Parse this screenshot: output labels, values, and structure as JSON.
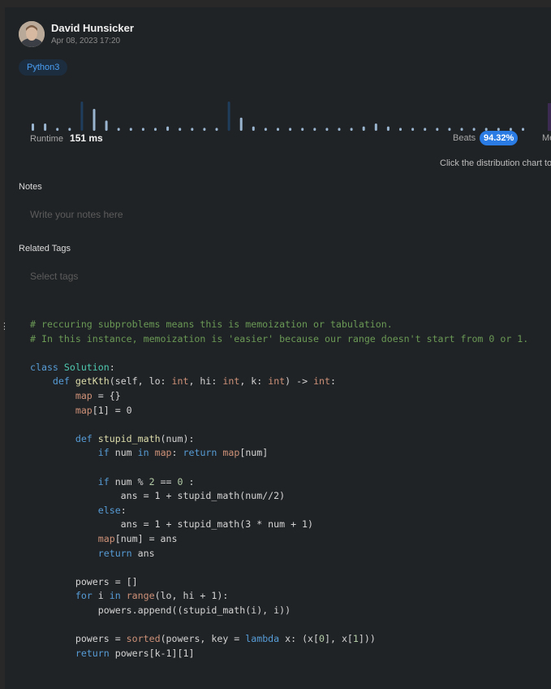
{
  "author": {
    "name": "David Hunsicker",
    "date": "Apr 08, 2023 17:20"
  },
  "language_tag": "Python3",
  "distribution": {
    "bars": [
      0.25,
      0.25,
      0.1,
      0.1,
      1.0,
      0.75,
      0.35,
      0.1,
      0.1,
      0.1,
      0.1,
      0.15,
      0.1,
      0.1,
      0.1,
      0.1,
      1.0,
      0.45,
      0.15,
      0.1,
      0.1,
      0.1,
      0.1,
      0.1,
      0.1,
      0.1,
      0.1,
      0.15,
      0.25,
      0.15,
      0.1,
      0.1,
      0.1,
      0.1,
      0.1,
      0.1,
      0.1,
      0.1,
      0.1,
      0.1,
      0.1
    ],
    "highlighted": [
      4,
      16,
      41
    ],
    "colors": {
      "bar": "#9ab5cf",
      "bar_highlight": "#1f3d5c",
      "memory_bar": "#3d2a52"
    }
  },
  "runtime": {
    "label": "Runtime",
    "value": "151 ms"
  },
  "beats": {
    "label": "Beats",
    "value": "94.32%"
  },
  "memory_label": "Me",
  "chart_hint": "Click the distribution chart to",
  "notes": {
    "label": "Notes",
    "placeholder": "Write your notes here"
  },
  "related_tags": {
    "label": "Related Tags",
    "placeholder": "Select tags"
  },
  "side_handle": "⋮",
  "code": {
    "language": "python",
    "colors": {
      "comment": "#6a9955",
      "keyword": "#569cd6",
      "class_name": "#4ec9b0",
      "function": "#dcdcaa",
      "builtin": "#ce9178",
      "number": "#b5cea8",
      "default": "#d4d4d4"
    },
    "lines": [
      [
        {
          "t": "# reccuring subproblems means this is memoization or tabulation.",
          "c": "comment"
        }
      ],
      [
        {
          "t": "# In this instance, memoization is 'easier' because our range doesn't start from 0 or 1.",
          "c": "comment"
        }
      ],
      [],
      [
        {
          "t": "class ",
          "c": "keyword"
        },
        {
          "t": "Solution",
          "c": "class_name"
        },
        {
          "t": ":",
          "c": "default"
        }
      ],
      [
        {
          "t": "    ",
          "c": "default"
        },
        {
          "t": "def ",
          "c": "keyword"
        },
        {
          "t": "getKth",
          "c": "function"
        },
        {
          "t": "(self, lo: ",
          "c": "default"
        },
        {
          "t": "int",
          "c": "builtin"
        },
        {
          "t": ", hi: ",
          "c": "default"
        },
        {
          "t": "int",
          "c": "builtin"
        },
        {
          "t": ", k: ",
          "c": "default"
        },
        {
          "t": "int",
          "c": "builtin"
        },
        {
          "t": ") -> ",
          "c": "default"
        },
        {
          "t": "int",
          "c": "builtin"
        },
        {
          "t": ":",
          "c": "default"
        }
      ],
      [
        {
          "t": "        ",
          "c": "default"
        },
        {
          "t": "map",
          "c": "builtin"
        },
        {
          "t": " = {}",
          "c": "default"
        }
      ],
      [
        {
          "t": "        ",
          "c": "default"
        },
        {
          "t": "map",
          "c": "builtin"
        },
        {
          "t": "[1] = 0",
          "c": "default"
        }
      ],
      [],
      [
        {
          "t": "        ",
          "c": "default"
        },
        {
          "t": "def ",
          "c": "keyword"
        },
        {
          "t": "stupid_math",
          "c": "function"
        },
        {
          "t": "(num):",
          "c": "default"
        }
      ],
      [
        {
          "t": "            ",
          "c": "default"
        },
        {
          "t": "if ",
          "c": "keyword"
        },
        {
          "t": "num ",
          "c": "default"
        },
        {
          "t": "in ",
          "c": "keyword"
        },
        {
          "t": "map",
          "c": "builtin"
        },
        {
          "t": ": ",
          "c": "default"
        },
        {
          "t": "return ",
          "c": "keyword"
        },
        {
          "t": "map",
          "c": "builtin"
        },
        {
          "t": "[num]",
          "c": "default"
        }
      ],
      [],
      [
        {
          "t": "            ",
          "c": "default"
        },
        {
          "t": "if ",
          "c": "keyword"
        },
        {
          "t": "num % ",
          "c": "default"
        },
        {
          "t": "2",
          "c": "number"
        },
        {
          "t": " == ",
          "c": "default"
        },
        {
          "t": "0",
          "c": "number"
        },
        {
          "t": " :",
          "c": "default"
        }
      ],
      [
        {
          "t": "                ans = 1 + stupid_math(num//2)",
          "c": "default"
        }
      ],
      [
        {
          "t": "            ",
          "c": "default"
        },
        {
          "t": "else",
          "c": "keyword"
        },
        {
          "t": ":",
          "c": "default"
        }
      ],
      [
        {
          "t": "                ans = 1 + stupid_math(3 * num + 1)",
          "c": "default"
        }
      ],
      [
        {
          "t": "            ",
          "c": "default"
        },
        {
          "t": "map",
          "c": "builtin"
        },
        {
          "t": "[num] = ans",
          "c": "default"
        }
      ],
      [
        {
          "t": "            ",
          "c": "default"
        },
        {
          "t": "return ",
          "c": "keyword"
        },
        {
          "t": "ans",
          "c": "default"
        }
      ],
      [],
      [
        {
          "t": "        powers = []",
          "c": "default"
        }
      ],
      [
        {
          "t": "        ",
          "c": "default"
        },
        {
          "t": "for ",
          "c": "keyword"
        },
        {
          "t": "i ",
          "c": "default"
        },
        {
          "t": "in ",
          "c": "keyword"
        },
        {
          "t": "range",
          "c": "builtin"
        },
        {
          "t": "(lo, hi + 1):",
          "c": "default"
        }
      ],
      [
        {
          "t": "            powers.append((stupid_math(i), i))",
          "c": "default"
        }
      ],
      [],
      [
        {
          "t": "        powers = ",
          "c": "default"
        },
        {
          "t": "sorted",
          "c": "builtin"
        },
        {
          "t": "(powers, key = ",
          "c": "default"
        },
        {
          "t": "lambda ",
          "c": "keyword"
        },
        {
          "t": "x: (x[",
          "c": "default"
        },
        {
          "t": "0",
          "c": "number"
        },
        {
          "t": "], x[",
          "c": "default"
        },
        {
          "t": "1",
          "c": "number"
        },
        {
          "t": "]))",
          "c": "default"
        }
      ],
      [
        {
          "t": "        ",
          "c": "default"
        },
        {
          "t": "return ",
          "c": "keyword"
        },
        {
          "t": "powers[k-1][1]",
          "c": "default"
        }
      ]
    ]
  }
}
